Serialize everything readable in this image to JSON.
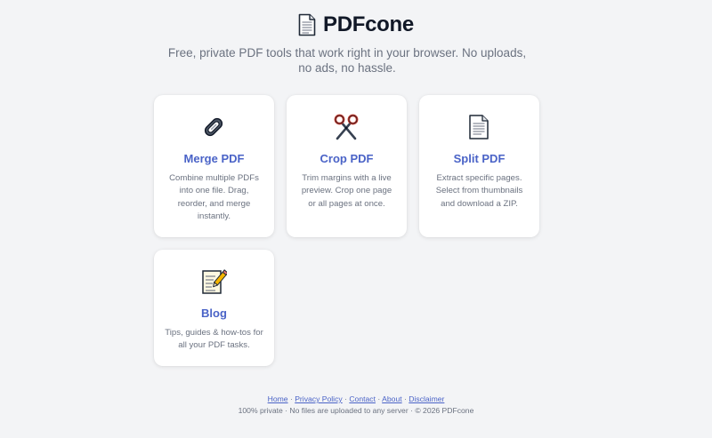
{
  "header": {
    "logo_icon": "document-icon",
    "title": "PDFcone",
    "tagline": "Free, private PDF tools that work right in your browser. No uploads, no ads, no hassle."
  },
  "tools": [
    {
      "icon": "paperclip-icon",
      "title": "Merge PDF",
      "description": "Combine multiple PDFs into one file. Drag, reorder, and merge instantly."
    },
    {
      "icon": "scissors-icon",
      "title": "Crop PDF",
      "description": "Trim margins with a live preview. Crop one page or all pages at once."
    },
    {
      "icon": "page-icon",
      "title": "Split PDF",
      "description": "Extract specific pages. Select from thumbnails and download a ZIP."
    },
    {
      "icon": "memo-icon",
      "title": "Blog",
      "description": "Tips, guides & how-tos for all your PDF tasks."
    }
  ],
  "footer": {
    "links": [
      "Home",
      "Privacy Policy",
      "Contact",
      "About",
      "Disclaimer"
    ],
    "separator": "·",
    "note": "100% private · No files are uploaded to any server · © 2026 PDFcone"
  },
  "colors": {
    "background": "#f3f4f6",
    "card": "#ffffff",
    "accent": "#4a63c7",
    "muted_text": "#6b7280"
  }
}
